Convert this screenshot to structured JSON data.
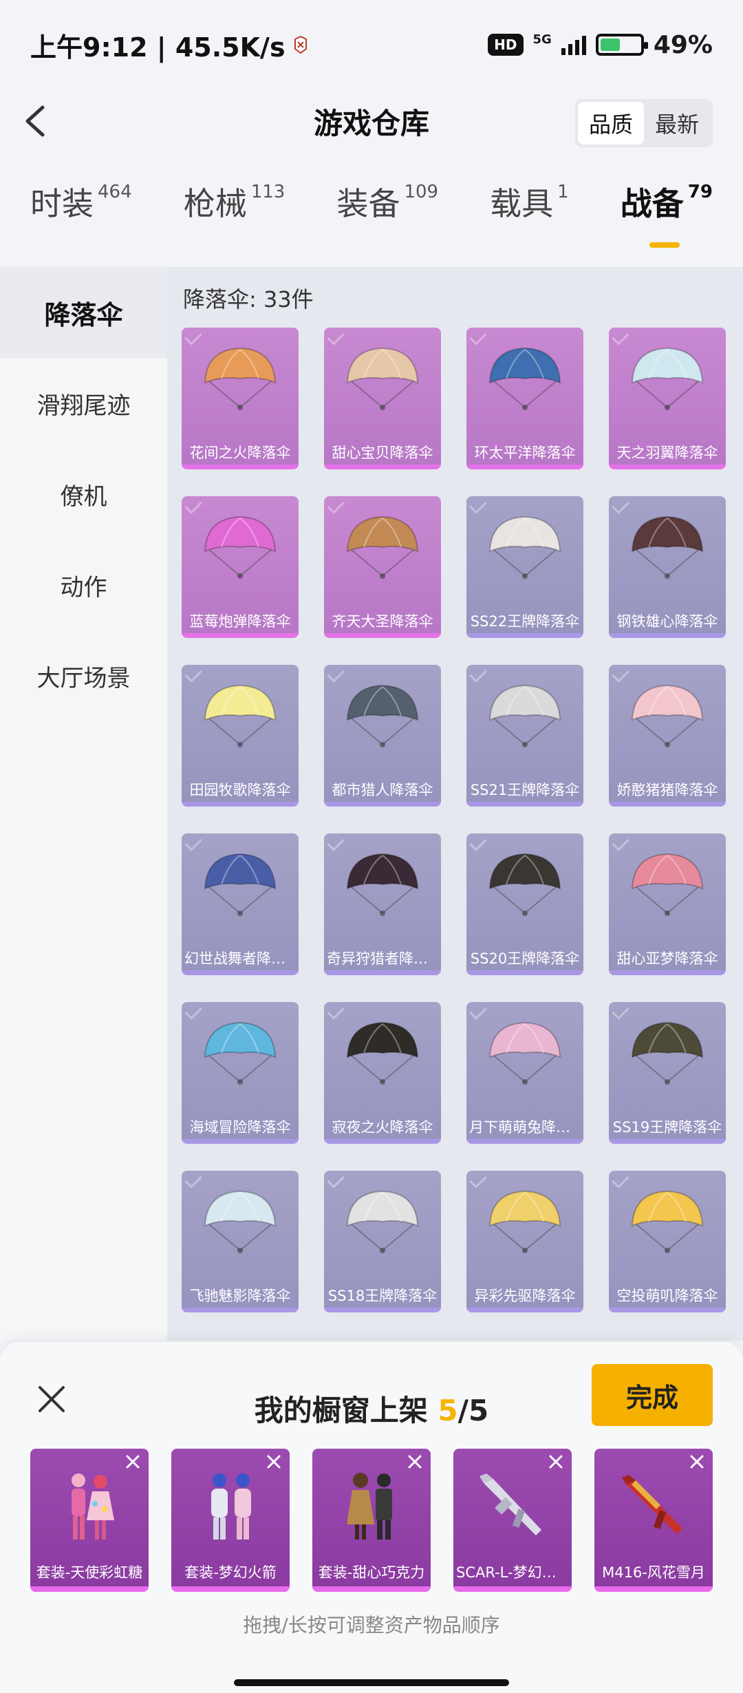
{
  "status_bar": {
    "time_speed": "上午9:12 | 45.5K/s",
    "hd": "HD",
    "network": "5G",
    "battery": "49%"
  },
  "header": {
    "title": "游戏仓库",
    "sort_quality": "品质",
    "sort_latest": "最新"
  },
  "category_tabs": [
    {
      "label": "时装",
      "count": "464"
    },
    {
      "label": "枪械",
      "count": "113"
    },
    {
      "label": "装备",
      "count": "109"
    },
    {
      "label": "载具",
      "count": "1"
    },
    {
      "label": "战备",
      "count": "79"
    }
  ],
  "sidebar": {
    "items": [
      {
        "label": "降落伞"
      },
      {
        "label": "滑翔尾迹"
      },
      {
        "label": "僚机"
      },
      {
        "label": "动作"
      },
      {
        "label": "大厅场景"
      }
    ]
  },
  "content": {
    "count_label": "降落伞: 33件",
    "items": [
      {
        "name": "花间之火降落伞",
        "tier": "pink",
        "color": "#e79b59"
      },
      {
        "name": "甜心宝贝降落伞",
        "tier": "pink",
        "color": "#e6c7a8"
      },
      {
        "name": "环太平洋降落伞",
        "tier": "pink",
        "color": "#3f6fb0"
      },
      {
        "name": "天之羽翼降落伞",
        "tier": "pink",
        "color": "#cfe7ef"
      },
      {
        "name": "蓝莓炮弹降落伞",
        "tier": "pink",
        "color": "#e06ad2"
      },
      {
        "name": "齐天大圣降落伞",
        "tier": "pink",
        "color": "#c48a55"
      },
      {
        "name": "SS22王牌降落伞",
        "tier": "blue",
        "color": "#e8e4e2"
      },
      {
        "name": "钢铁雄心降落伞",
        "tier": "blue",
        "color": "#5a3a3a"
      },
      {
        "name": "田园牧歌降落伞",
        "tier": "blue",
        "color": "#f4eb94"
      },
      {
        "name": "都市猎人降落伞",
        "tier": "blue",
        "color": "#55606f"
      },
      {
        "name": "SS21王牌降落伞",
        "tier": "blue",
        "color": "#dadada"
      },
      {
        "name": "娇憨猪猪降落伞",
        "tier": "blue",
        "color": "#f2c6cc"
      },
      {
        "name": "幻世战舞者降落伞",
        "tier": "blue",
        "color": "#4a5ea8"
      },
      {
        "name": "奇异狩猎者降落伞",
        "tier": "blue",
        "color": "#3a2a35"
      },
      {
        "name": "SS20王牌降落伞",
        "tier": "blue",
        "color": "#3a3632"
      },
      {
        "name": "甜心亚梦降落伞",
        "tier": "blue",
        "color": "#e78a9b"
      },
      {
        "name": "海域冒险降落伞",
        "tier": "blue",
        "color": "#5fb7de"
      },
      {
        "name": "寂夜之火降落伞",
        "tier": "blue",
        "color": "#2f2c28"
      },
      {
        "name": "月下萌萌兔降落伞",
        "tier": "blue",
        "color": "#e8b6d0"
      },
      {
        "name": "SS19王牌降落伞",
        "tier": "blue",
        "color": "#4e4a38"
      },
      {
        "name": "飞驰魅影降落伞",
        "tier": "blue",
        "color": "#d8e8f0"
      },
      {
        "name": "SS18王牌降落伞",
        "tier": "blue",
        "color": "#e2e2e2"
      },
      {
        "name": "异彩先驱降落伞",
        "tier": "blue",
        "color": "#f0d06a"
      },
      {
        "name": "空投萌叽降落伞",
        "tier": "blue",
        "color": "#f3c64e"
      }
    ]
  },
  "showcase": {
    "title": "我的橱窗上架",
    "current": "5",
    "sep": "/",
    "total": "5",
    "done_label": "完成",
    "items": [
      {
        "name": "套装-天使彩虹糖"
      },
      {
        "name": "套装-梦幻火箭"
      },
      {
        "name": "套装-甜心巧克力"
      },
      {
        "name": "SCAR-L-梦幻火箭"
      },
      {
        "name": "M416-风花雪月"
      }
    ],
    "hint": "拖拽/长按可调整资产物品顺序"
  }
}
